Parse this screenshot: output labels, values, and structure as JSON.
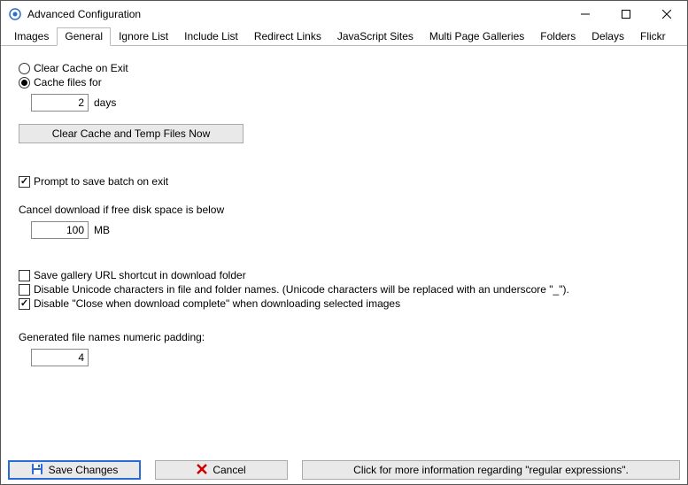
{
  "window": {
    "title": "Advanced Configuration"
  },
  "tabs": [
    {
      "label": "Images"
    },
    {
      "label": "General"
    },
    {
      "label": "Ignore List"
    },
    {
      "label": "Include List"
    },
    {
      "label": "Redirect Links"
    },
    {
      "label": "JavaScript Sites"
    },
    {
      "label": "Multi Page Galleries"
    },
    {
      "label": "Folders"
    },
    {
      "label": "Delays"
    },
    {
      "label": "Flickr"
    }
  ],
  "active_tab": 1,
  "cache": {
    "clear_on_exit_label": "Clear Cache on Exit",
    "cache_for_label": "Cache files for",
    "days_value": "2",
    "days_unit": "days",
    "clear_now_button": "Clear Cache and Temp Files Now"
  },
  "prompt_save_label": "Prompt to save batch on exit",
  "disk": {
    "label": "Cancel download if free disk space is below",
    "value": "100",
    "unit": "MB"
  },
  "checkboxes": {
    "save_shortcut": "Save gallery URL shortcut in download folder",
    "disable_unicode": "Disable Unicode characters in file and folder names. (Unicode characters will be replaced with an underscore \"_\").",
    "disable_close": "Disable \"Close when download complete\" when downloading selected images"
  },
  "padding": {
    "label": "Generated file names numeric padding:",
    "value": "4"
  },
  "buttons": {
    "save": "Save Changes",
    "cancel": "Cancel",
    "info": "Click for more information regarding \"regular expressions\"."
  }
}
